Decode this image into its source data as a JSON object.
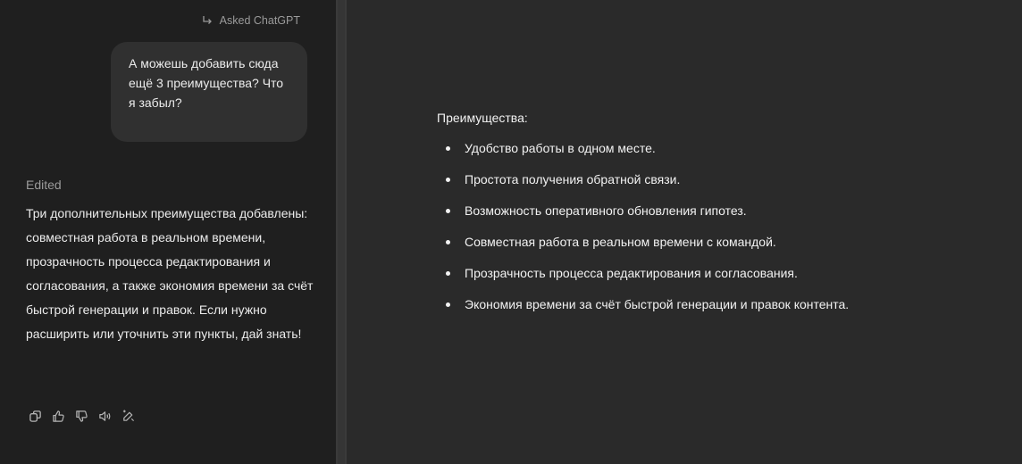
{
  "chat": {
    "asked_label": "Asked ChatGPT",
    "user_message": "А можешь добавить сюда ещё 3 преимущества? Что я забыл?",
    "edited_label": "Edited",
    "assistant_message": "Три дополнительных преимущества добавлены: совместная работа в реальном времени, прозрачность процесса редактирования и согласования, а также экономия времени за счёт быстрой генерации и правок. Если нужно расширить или уточнить эти пункты, дай знать!",
    "actions": [
      {
        "name": "copy-icon"
      },
      {
        "name": "thumbs-up-icon"
      },
      {
        "name": "thumbs-down-icon"
      },
      {
        "name": "read-aloud-icon"
      },
      {
        "name": "edit-in-canvas-icon"
      }
    ]
  },
  "canvas": {
    "heading": "Преимущества:",
    "items": [
      "Удобство работы в одном месте.",
      "Простота получения обратной связи.",
      "Возможность оперативного обновления гипотез.",
      "Совместная работа в реальном времени с командой.",
      "Прозрачность процесса редактирования и согласования.",
      "Экономия времени за счёт быстрой генерации и правок контента."
    ]
  },
  "colors": {
    "chat_background": "#1f1f1f",
    "canvas_background": "#2a2a2a",
    "bubble": "#303030",
    "muted_text": "#9b9b9b"
  }
}
